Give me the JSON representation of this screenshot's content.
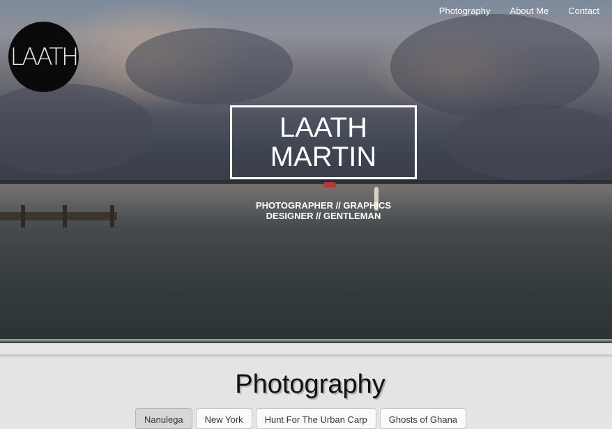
{
  "logo": {
    "text": "LAATH"
  },
  "nav": {
    "items": [
      {
        "label": "Photography"
      },
      {
        "label": "About Me"
      },
      {
        "label": "Contact"
      }
    ]
  },
  "hero": {
    "title_line1": "LAATH",
    "title_line2": "MARTIN",
    "tagline_line1": "PHOTOGRAPHER // GRAPHICS",
    "tagline_line2": "DESIGNER // GENTLEMAN"
  },
  "section": {
    "title": "Photography",
    "tabs": [
      {
        "label": "Nanulega",
        "active": true
      },
      {
        "label": "New York",
        "active": false
      },
      {
        "label": "Hunt For The Urban Carp",
        "active": false
      },
      {
        "label": "Ghosts of Ghana",
        "active": false
      }
    ]
  }
}
